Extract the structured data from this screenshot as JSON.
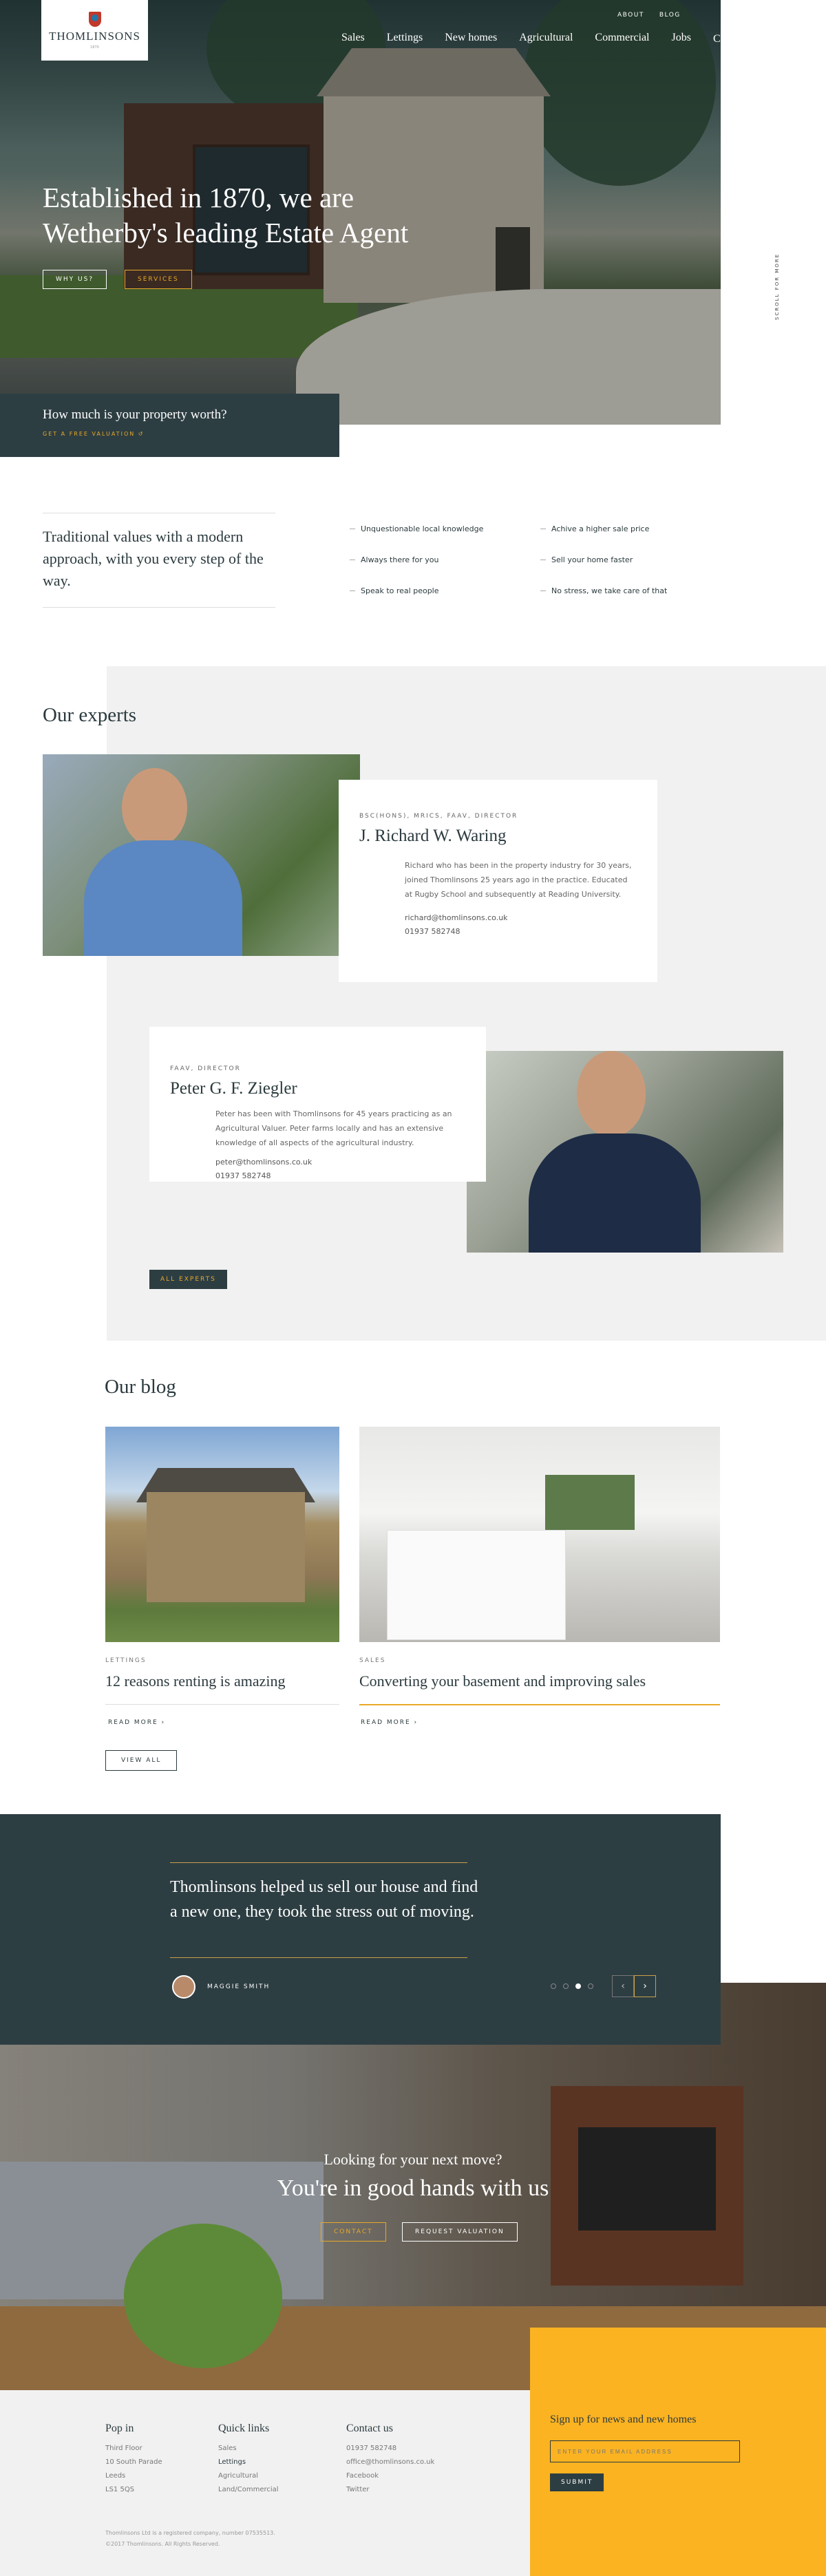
{
  "brand": {
    "name": "THOMLINSONS",
    "est": "1870"
  },
  "nav": {
    "top": [
      "ABOUT",
      "BLOG"
    ],
    "main": [
      "Sales",
      "Lettings",
      "New homes",
      "Agricultural",
      "Commercial",
      "Jobs",
      "Contact ▿"
    ]
  },
  "hero": {
    "title": "Established in 1870, we are Wetherby's leading Estate Agent",
    "btn_why": "WHY US?",
    "btn_services": "SERVICES",
    "scroll": "SCROLL FOR MORE"
  },
  "valuation": {
    "question": "How much is your property worth?",
    "link": "GET A FREE VALUATION ↺"
  },
  "values": {
    "statement": "Traditional values with a modern approach, with you every step of the way.",
    "features": [
      "Unquestionable local knowledge",
      "Achive a higher sale price",
      "Always there for you",
      "Sell your home faster",
      "Speak to real people",
      "No stress, we take care of that"
    ]
  },
  "experts": {
    "title": "Our experts",
    "people": [
      {
        "role": "BSC(HONS), MRICS, FAAV, DIRECTOR",
        "name": "J. Richard W. Waring",
        "bio": "Richard who has been in the property industry for 30 years, joined Thomlinsons 25 years ago in the practice. Educated at Rugby School and subsequently at Reading University.",
        "email": "richard@thomlinsons.co.uk",
        "phone": "01937 582748"
      },
      {
        "role": "FAAV, DIRECTOR",
        "name": "Peter G. F. Ziegler",
        "bio": "Peter has been with Thomlinsons for 45 years practicing as an Agricultural Valuer. Peter farms locally and has an extensive knowledge of all aspects of the agricultural industry.",
        "email": "peter@thomlinsons.co.uk",
        "phone": "01937 582748"
      }
    ],
    "all_btn": "ALL EXPERTS"
  },
  "blog": {
    "title": "Our blog",
    "posts": [
      {
        "category": "LETTINGS",
        "title": "12 reasons renting is amazing",
        "more": "READ MORE ›"
      },
      {
        "category": "SALES",
        "title": "Converting your basement and improving sales",
        "more": "READ MORE ›"
      }
    ],
    "view_all": "VIEW ALL"
  },
  "testimonial": {
    "quote": "Thomlinsons helped us sell our house and find a new one, they took the stress out of moving.",
    "author": "MAGGIE SMITH",
    "prev": "‹",
    "next": "›"
  },
  "cta": {
    "small": "Looking for your next move?",
    "big": "You're in good hands with us",
    "contact": "CONTACT",
    "request": "REQUEST VALUATION"
  },
  "footer": {
    "pop_in": {
      "title": "Pop in",
      "lines": [
        "Third Floor",
        "10 South Parade",
        "Leeds",
        "LS1 5QS"
      ]
    },
    "quick": {
      "title": "Quick links",
      "lines": [
        "Sales",
        "Lettings",
        "Agricultural",
        "Land/Commercial"
      ]
    },
    "contact": {
      "title": "Contact us",
      "lines": [
        "01937 582748",
        "office@thomlinsons.co.uk",
        "Facebook",
        "Twitter"
      ]
    },
    "newsletter": {
      "title": "Sign up for news and new homes",
      "placeholder": "ENTER YOUR EMAIL ADDRESS",
      "submit": "SUBMIT"
    },
    "legal": [
      "Thomlinsons Ltd is a registered company, number 07535513.",
      "©2017 Thomlinsons. All Rights Reserved."
    ]
  }
}
